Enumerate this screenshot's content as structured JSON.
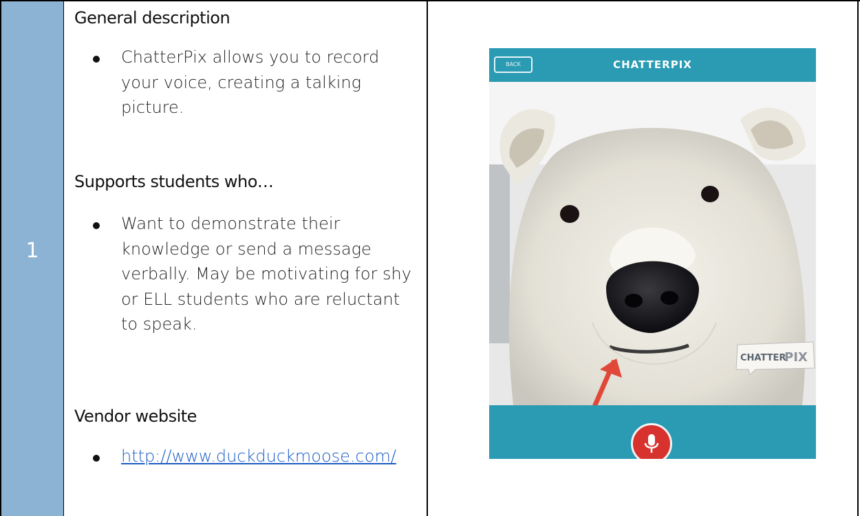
{
  "row": {
    "number": "1"
  },
  "sections": [
    {
      "heading": "General description",
      "bullets": [
        "ChatterPix allows you to record your voice, creating a talking picture."
      ]
    },
    {
      "heading": "Supports students who…",
      "bullets": [
        "Want to demonstrate their knowledge or send a message verbally.  May be motivating for shy or ELL students who are reluctant to speak."
      ]
    },
    {
      "heading": "Vendor website",
      "bullets": [
        "http://www.duckduckmoose.com/"
      ]
    }
  ],
  "app_screenshot": {
    "back_label": "BACK",
    "title": "CHATTERPIX",
    "watermark_left": "CHATTER",
    "watermark_right": "PIX",
    "icons": [
      "mic-icon",
      "arrow-icon"
    ]
  },
  "colors": {
    "number_cell": "#8db3d4",
    "app_teal": "#2a9bb3",
    "record_red": "#d8322e",
    "link": "#1a5bc4"
  }
}
